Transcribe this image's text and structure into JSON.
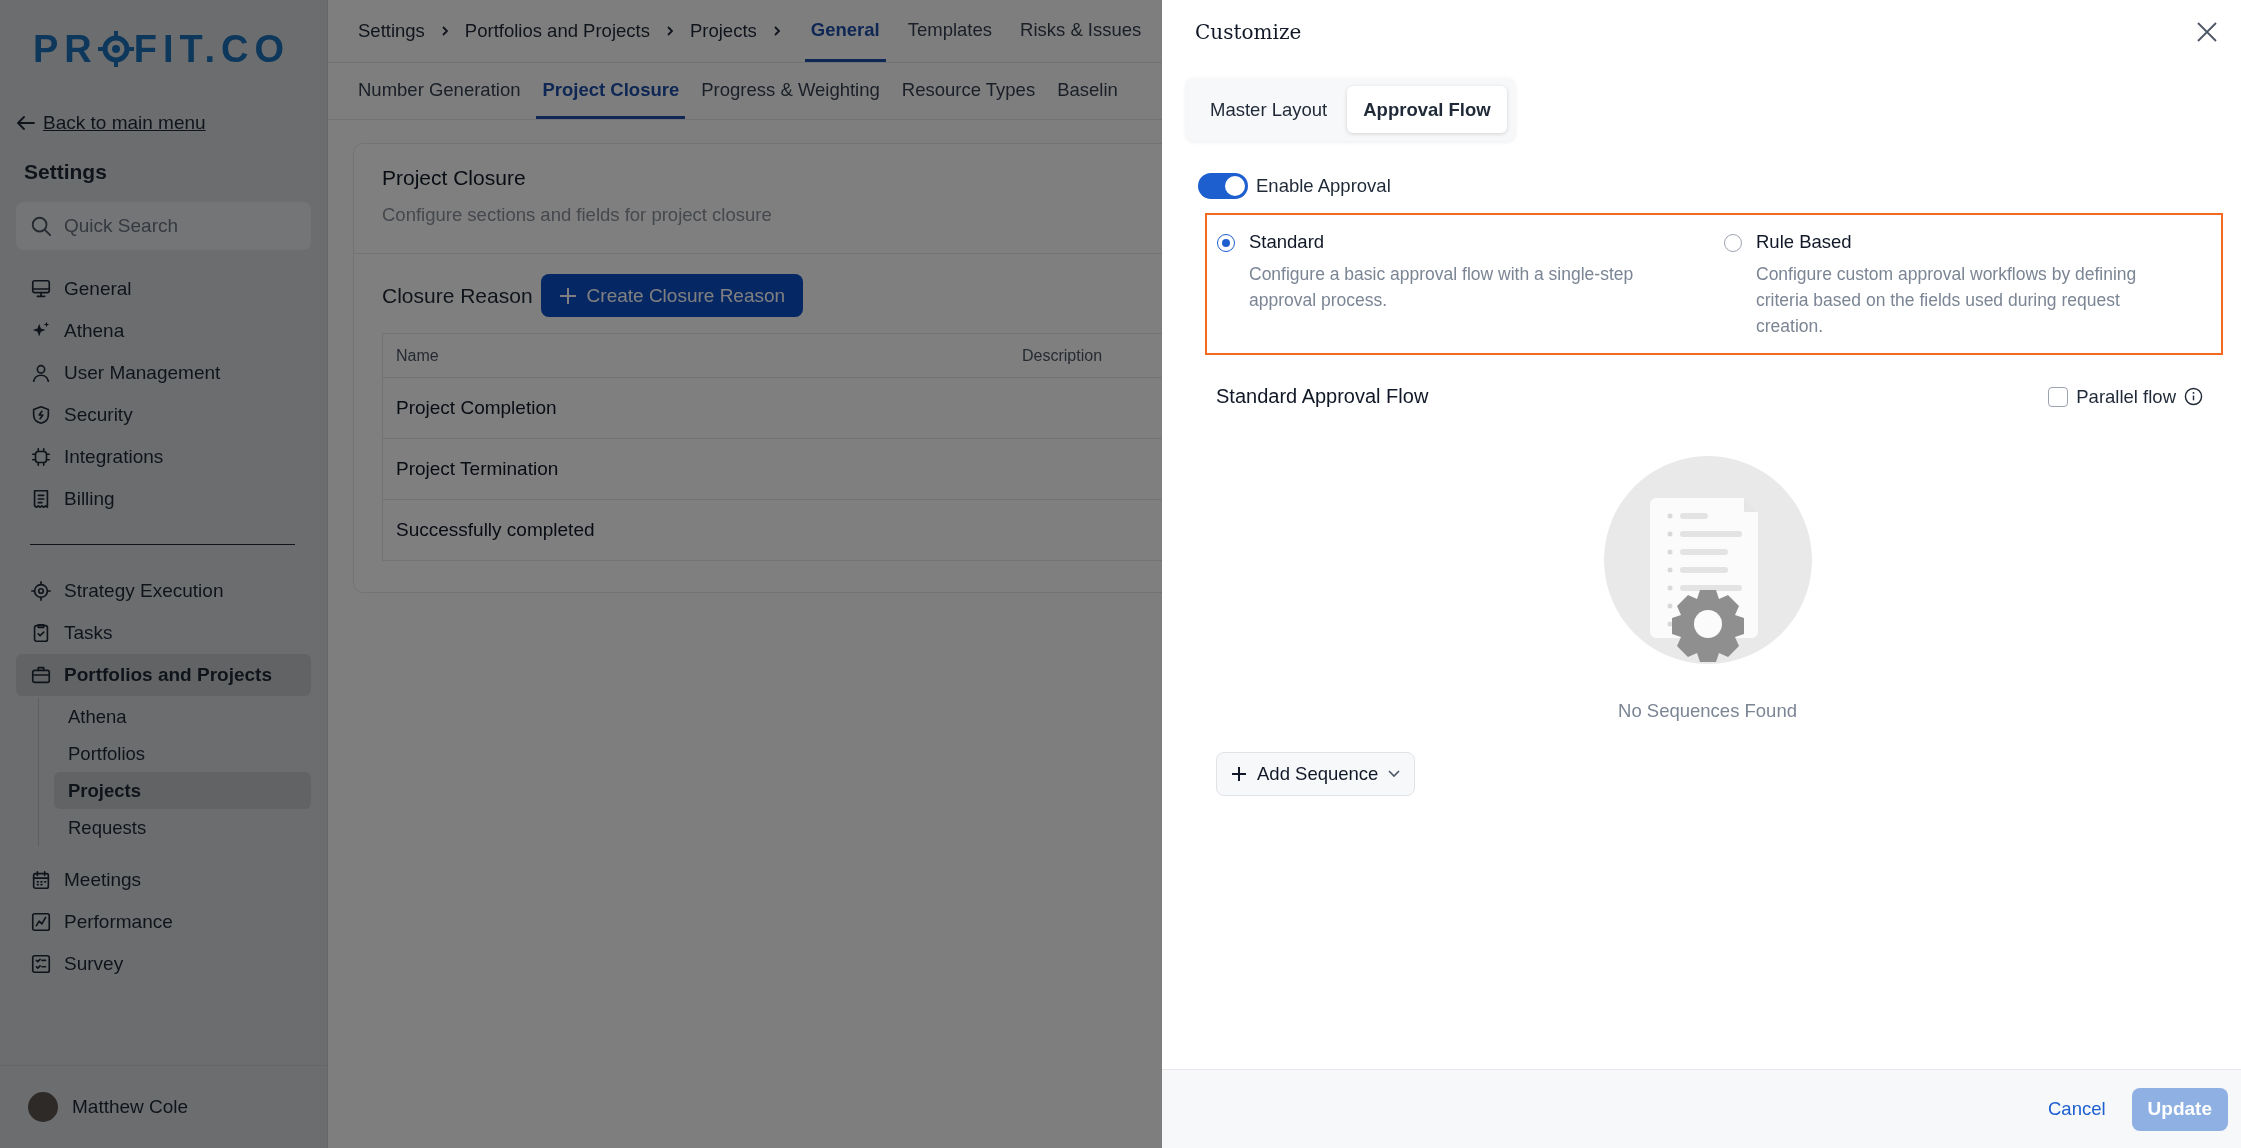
{
  "logo": {
    "before": "PR",
    "after": "FIT.CO"
  },
  "sidebar": {
    "back_link": "Back to main menu",
    "title": "Settings",
    "search": {
      "placeholder": "Quick Search"
    },
    "groups": [
      [
        {
          "label": "General",
          "selected": false
        },
        {
          "label": "Athena",
          "selected": false
        },
        {
          "label": "User Management",
          "selected": false
        },
        {
          "label": "Security",
          "selected": false
        },
        {
          "label": "Integrations",
          "selected": false
        },
        {
          "label": "Billing",
          "selected": false
        }
      ],
      [
        {
          "label": "Strategy Execution",
          "selected": false
        },
        {
          "label": "Tasks",
          "selected": false
        },
        {
          "label": "Portfolios and Projects",
          "selected": true,
          "children": [
            {
              "label": "Athena",
              "selected": false
            },
            {
              "label": "Portfolios",
              "selected": false
            },
            {
              "label": "Projects",
              "selected": true
            },
            {
              "label": "Requests",
              "selected": false
            }
          ]
        },
        {
          "label": "Meetings",
          "selected": false
        },
        {
          "label": "Performance",
          "selected": false
        },
        {
          "label": "Survey",
          "selected": false
        }
      ]
    ],
    "user": {
      "name": "Matthew Cole"
    }
  },
  "breadcrumbs": [
    "Settings",
    "Portfolios and Projects",
    "Projects"
  ],
  "tabs": [
    {
      "label": "General",
      "selected": true
    },
    {
      "label": "Templates",
      "selected": false
    },
    {
      "label": "Risks & Issues",
      "selected": false
    }
  ],
  "subtabs": [
    {
      "label": "Number Generation",
      "selected": false
    },
    {
      "label": "Project Closure",
      "selected": true
    },
    {
      "label": "Progress & Weighting",
      "selected": false
    },
    {
      "label": "Resource Types",
      "selected": false
    },
    {
      "label": "Baselin",
      "selected": false
    }
  ],
  "card": {
    "title": "Project Closure",
    "subtitle": "Configure sections and fields for project closure",
    "section": "Closure Reason",
    "create_button": "Create Closure Reason",
    "table": {
      "columns": [
        "Name",
        "Description"
      ],
      "rows": [
        [
          "Project Completion"
        ],
        [
          "Project Termination"
        ],
        [
          "Successfully completed"
        ]
      ]
    }
  },
  "drawer": {
    "title": "Customize",
    "tabs": [
      {
        "label": "Master Layout",
        "selected": false
      },
      {
        "label": "Approval Flow",
        "selected": true
      }
    ],
    "enable": {
      "label": "Enable Approval",
      "on": true
    },
    "options": [
      {
        "title": "Standard",
        "description": "Configure a basic approval flow with a single-step approval process.",
        "selected": true
      },
      {
        "title": "Rule Based",
        "description": "Configure custom approval workflows by defining criteria based on the fields used during request creation.",
        "selected": false
      }
    ],
    "flow": {
      "title": "Standard Approval Flow",
      "parallel": {
        "label": "Parallel flow",
        "checked": false
      }
    },
    "empty": "No Sequences Found",
    "add_button": "Add Sequence",
    "footer": {
      "cancel": "Cancel",
      "update": {
        "label": "Update",
        "disabled": true
      }
    }
  }
}
